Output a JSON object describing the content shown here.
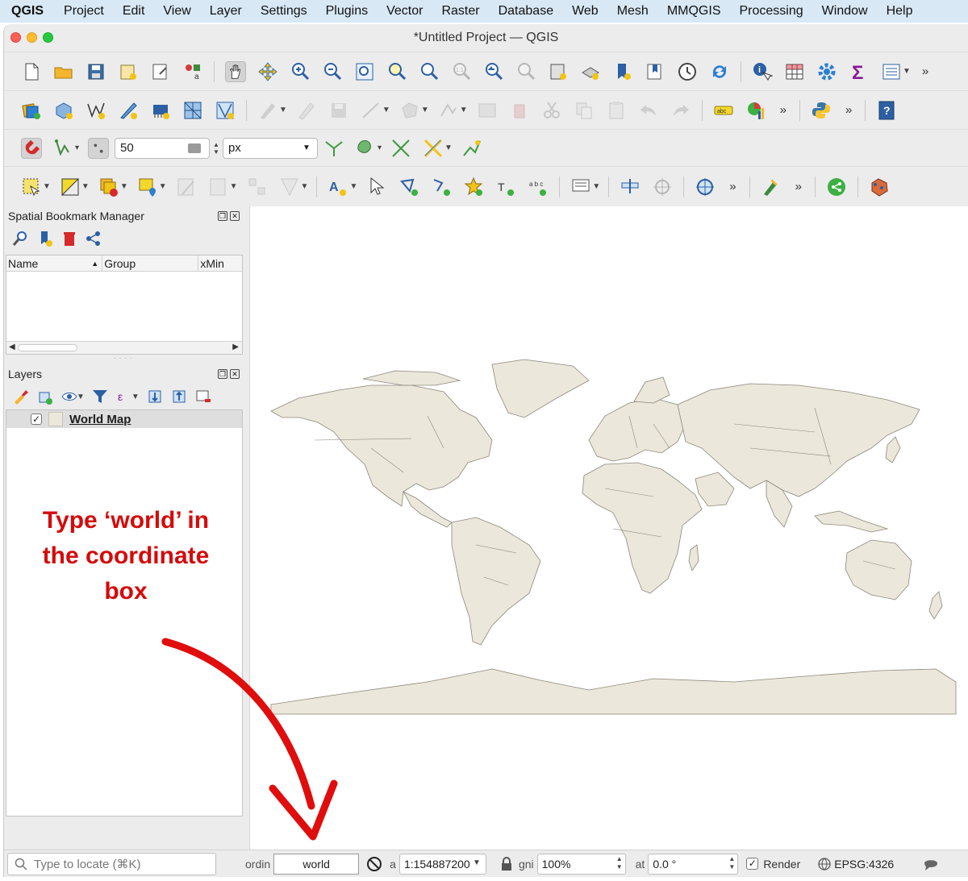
{
  "menubar": {
    "app": "QGIS",
    "items": [
      "Project",
      "Edit",
      "View",
      "Layer",
      "Settings",
      "Plugins",
      "Vector",
      "Raster",
      "Database",
      "Web",
      "Mesh",
      "MMQGIS",
      "Processing",
      "Window",
      "Help"
    ]
  },
  "window": {
    "title": "*Untitled Project — QGIS"
  },
  "snapping": {
    "tolerance": "50",
    "units": "px"
  },
  "bookmarks": {
    "title": "Spatial Bookmark Manager",
    "columns": [
      "Name",
      "Group",
      "xMin"
    ]
  },
  "layers": {
    "title": "Layers",
    "items": [
      {
        "name": "World Map",
        "checked": "✓"
      }
    ]
  },
  "annotation": {
    "lines": [
      "Type ‘world’ in",
      "the coordinate",
      "box"
    ],
    "color": "#d40b0b"
  },
  "statusbar": {
    "locator_placeholder": "Type to locate (⌘K)",
    "coord_label": "ordin",
    "coord_value": "world",
    "scale_label": "a",
    "scale_value": "1:154887200",
    "magnifier_label": "gni",
    "magnifier_value": "100%",
    "rotation_label": "at",
    "rotation_value": "0.0 °",
    "render_label": "Render",
    "render_checked": "✓",
    "crs": "EPSG:4326"
  },
  "map": {
    "land_color": "#ebe7db",
    "outline_color": "#8c877a"
  }
}
